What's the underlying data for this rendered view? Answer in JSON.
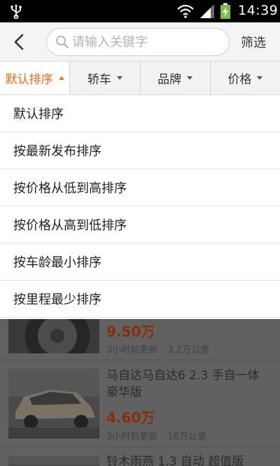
{
  "status_bar": {
    "time": "14:39",
    "icons": [
      "usb-icon",
      "wifi-icon",
      "signal-icon",
      "battery-charging-icon"
    ]
  },
  "header": {
    "back_icon": "back-arrow-icon",
    "search_icon": "search-icon",
    "search_placeholder": "请输入关键字",
    "search_value": "",
    "filter_label": "筛选"
  },
  "tabs": [
    {
      "label": "默认排序",
      "active": true
    },
    {
      "label": "轿车",
      "active": false
    },
    {
      "label": "品牌",
      "active": false
    },
    {
      "label": "价格",
      "active": false
    }
  ],
  "sort_menu": [
    "默认排序",
    "按最新发布排序",
    "按价格从低到高排序",
    "按价格从高到低排序",
    "按车龄最小排序",
    "按里程最少排序"
  ],
  "listings": [
    {
      "title": "",
      "price": "9.50万",
      "updated": "3小时前更新",
      "mileage": "3.2万公里"
    },
    {
      "title": "马自达马自达6 2.3 手自一体 豪华版",
      "price": "4.60万",
      "updated": "3小时前更新",
      "mileage": "16万公里"
    },
    {
      "title": "铃木雨燕 1.3 自动 超值版",
      "price": "",
      "updated": "",
      "mileage": ""
    }
  ],
  "colors": {
    "accent": "#ee6a17",
    "price": "#c8401a",
    "overlay_dim": "#5a5a5a"
  }
}
